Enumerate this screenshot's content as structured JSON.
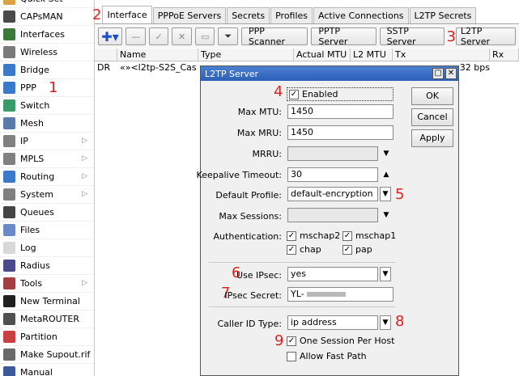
{
  "sidebar": {
    "items": [
      {
        "label": "Quick Set",
        "icon": "quick-set-icon",
        "color": "#d9a441"
      },
      {
        "label": "CAPsMAN",
        "icon": "capsman-icon",
        "color": "#4a4a4a"
      },
      {
        "label": "Interfaces",
        "icon": "interfaces-icon",
        "color": "#3b7a3b"
      },
      {
        "label": "Wireless",
        "icon": "wireless-icon",
        "color": "#7a7a7a"
      },
      {
        "label": "Bridge",
        "icon": "bridge-icon",
        "color": "#3a7ac8"
      },
      {
        "label": "PPP",
        "icon": "ppp-icon",
        "color": "#3a7ac8",
        "number": "1"
      },
      {
        "label": "Switch",
        "icon": "switch-icon",
        "color": "#3a9a6a"
      },
      {
        "label": "Mesh",
        "icon": "mesh-icon",
        "color": "#5a7aaa"
      },
      {
        "label": "IP",
        "icon": "ip-icon",
        "color": "#808080",
        "submenu": true
      },
      {
        "label": "MPLS",
        "icon": "mpls-icon",
        "color": "#808080",
        "submenu": true
      },
      {
        "label": "Routing",
        "icon": "routing-icon",
        "color": "#3a7ac8",
        "submenu": true
      },
      {
        "label": "System",
        "icon": "system-icon",
        "color": "#808080",
        "submenu": true
      },
      {
        "label": "Queues",
        "icon": "queues-icon",
        "color": "#444444"
      },
      {
        "label": "Files",
        "icon": "files-icon",
        "color": "#6a8ac8"
      },
      {
        "label": "Log",
        "icon": "log-icon",
        "color": "#d8d8d8"
      },
      {
        "label": "Radius",
        "icon": "radius-icon",
        "color": "#4a4a8a"
      },
      {
        "label": "Tools",
        "icon": "tools-icon",
        "color": "#a04040",
        "submenu": true
      },
      {
        "label": "New Terminal",
        "icon": "terminal-icon",
        "color": "#202020"
      },
      {
        "label": "MetaROUTER",
        "icon": "metarouter-icon",
        "color": "#505050"
      },
      {
        "label": "Partition",
        "icon": "partition-icon",
        "color": "#c84040"
      },
      {
        "label": "Make Supout.rif",
        "icon": "supout-icon",
        "color": "#6a6a6a"
      },
      {
        "label": "Manual",
        "icon": "manual-icon",
        "color": "#3a5a9a"
      }
    ]
  },
  "tabs": {
    "number": "2",
    "items": [
      "Interface",
      "PPPoE Servers",
      "Secrets",
      "Profiles",
      "Active Connections",
      "L2TP Secrets"
    ]
  },
  "toolbar": {
    "buttons": [
      "PPP Scanner",
      "PPTP Server",
      "SSTP Server",
      "L2TP Server"
    ],
    "l2tp_number": "3",
    "add_icon": "plus-icon",
    "remove_icon": "minus-icon",
    "enable_icon": "check-icon",
    "disable_icon": "x-icon",
    "comment_icon": "comment-icon",
    "filter_icon": "filter-icon"
  },
  "table": {
    "columns": [
      "",
      "Name",
      "Type",
      "Actual MTU",
      "L2 MTU",
      "Tx",
      "Rx"
    ],
    "rows": [
      {
        "flags": "DR",
        "name": "«»<l2tp-S2S_Cas",
        "type": "",
        "mtu": "",
        "l2mtu": "",
        "tx": "32 bps",
        "rx": ""
      }
    ]
  },
  "dialog": {
    "title": "L2TP Server",
    "enabled": {
      "label": "Enabled",
      "checked": true,
      "number": "4"
    },
    "max_mtu": {
      "label": "Max MTU:",
      "value": "1450"
    },
    "max_mru": {
      "label": "Max MRU:",
      "value": "1450"
    },
    "mrru": {
      "label": "MRRU:",
      "value": ""
    },
    "keepalive": {
      "label": "Keepalive Timeout:",
      "value": "30"
    },
    "default_profile": {
      "label": "Default Profile:",
      "value": "default-encryption",
      "number": "5"
    },
    "max_sessions": {
      "label": "Max Sessions:",
      "value": ""
    },
    "authentication": {
      "label": "Authentication:",
      "mschap2": "mschap2",
      "mschap1": "mschap1",
      "chap": "chap",
      "pap": "pap"
    },
    "use_ipsec": {
      "label": "Use IPsec:",
      "value": "yes",
      "number": "6"
    },
    "ipsec_secret": {
      "label": "IPsec Secret:",
      "value": "YL-",
      "number": "7"
    },
    "caller_id": {
      "label": "Caller ID Type:",
      "value": "ip address",
      "number": "8"
    },
    "one_session": {
      "label": "One Session Per Host",
      "checked": true,
      "number": "9"
    },
    "allow_fast_path": {
      "label": "Allow Fast Path",
      "checked": false
    },
    "buttons": {
      "ok": "OK",
      "cancel": "Cancel",
      "apply": "Apply"
    }
  }
}
